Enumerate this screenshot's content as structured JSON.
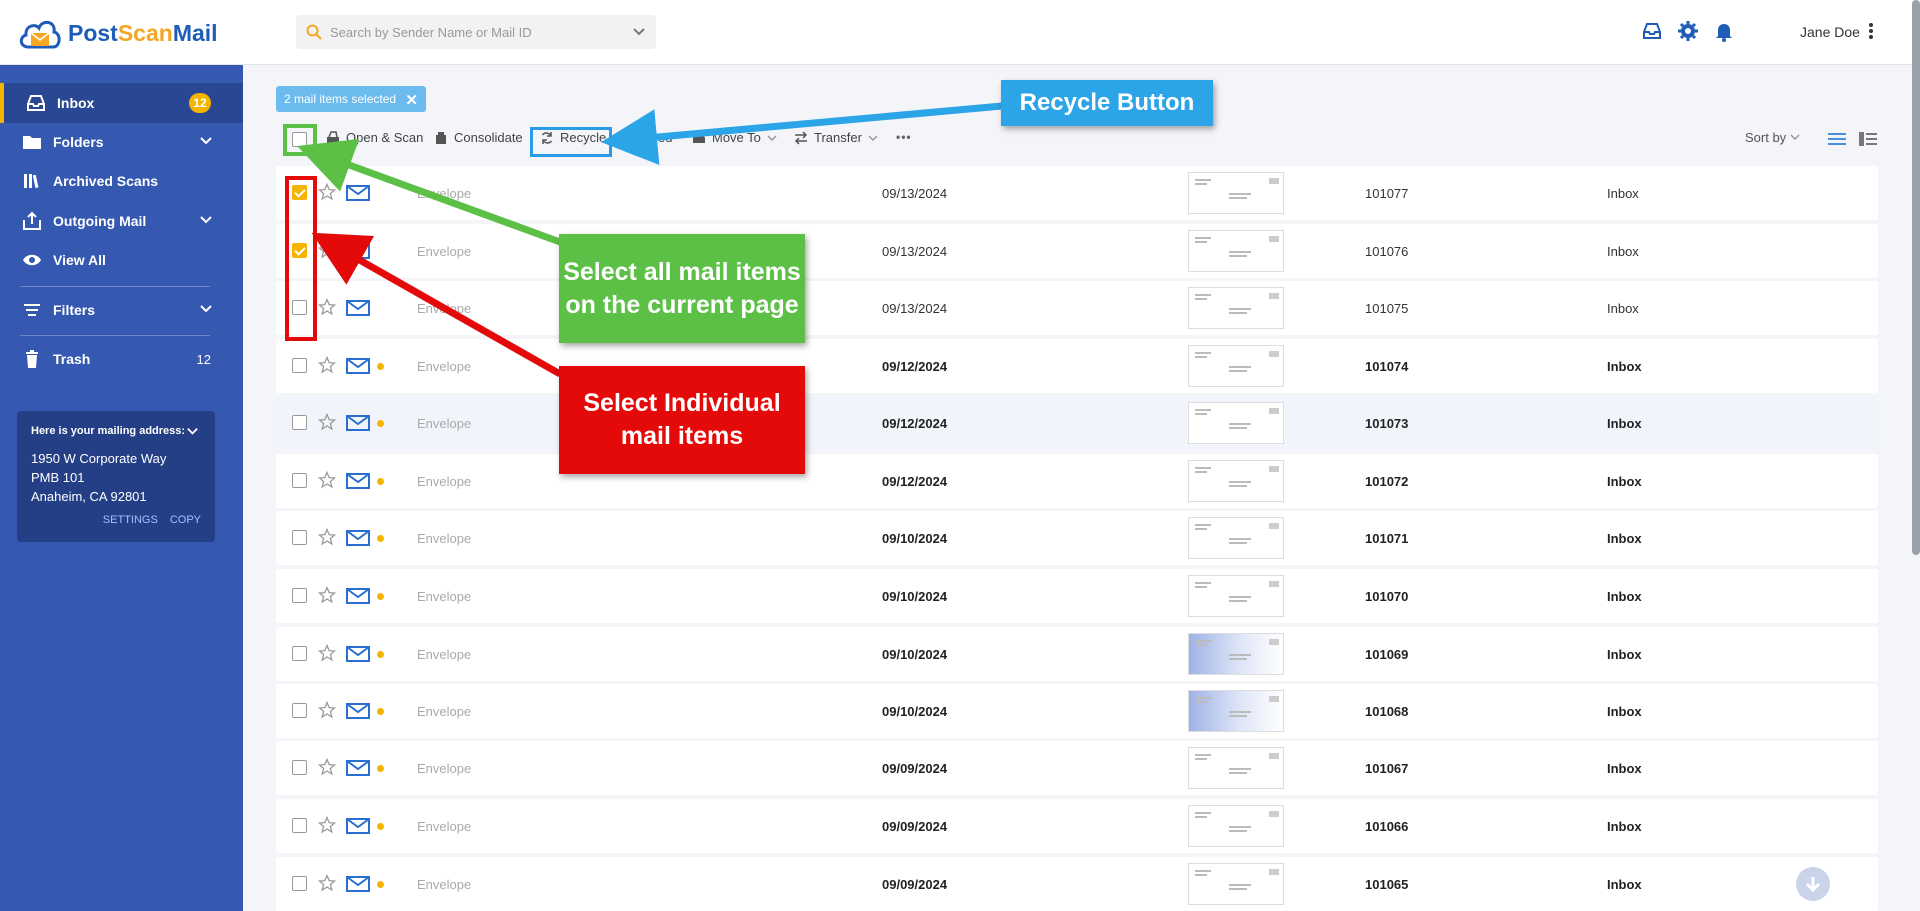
{
  "app": {
    "brand_part1": "Post",
    "brand_part2": "Scan",
    "brand_part3": "Mail",
    "user_name": "Jane Doe"
  },
  "search": {
    "placeholder": "Search by Sender Name or Mail ID"
  },
  "sidebar": {
    "items": [
      {
        "label": "Inbox",
        "badge": "12",
        "icon": "inbox-icon"
      },
      {
        "label": "Folders",
        "icon": "folder-icon"
      },
      {
        "label": "Archived Scans",
        "icon": "archive-icon"
      },
      {
        "label": "Outgoing Mail",
        "icon": "outgoing-mail-icon"
      },
      {
        "label": "View All",
        "icon": "eye-icon"
      },
      {
        "label": "Filters",
        "icon": "filter-icon"
      },
      {
        "label": "Trash",
        "count": "12",
        "icon": "trash-icon"
      }
    ],
    "address": {
      "title": "Here is your mailing address:",
      "line1": "1950 W Corporate Way",
      "line2": "PMB 101",
      "line3": "Anaheim, CA 92801",
      "settings": "SETTINGS",
      "copy": "COPY"
    }
  },
  "selection": {
    "label": "2 mail items selected"
  },
  "toolbar": {
    "open_scan": "Open & Scan",
    "consolidate": "Consolidate",
    "recycle": "Recycle",
    "shred_partial": "ed",
    "move_to": "Move To",
    "transfer": "Transfer",
    "more": "•••",
    "sort_by": "Sort by"
  },
  "rows": [
    {
      "sender": "Envelope",
      "date": "09/13/2024",
      "id": "101077",
      "location": "Inbox",
      "checked": true,
      "unread": false
    },
    {
      "sender": "Envelope",
      "date": "09/13/2024",
      "id": "101076",
      "location": "Inbox",
      "checked": true,
      "unread": false
    },
    {
      "sender": "Envelope",
      "date": "09/13/2024",
      "id": "101075",
      "location": "Inbox",
      "checked": false,
      "unread": false
    },
    {
      "sender": "Envelope",
      "date": "09/12/2024",
      "id": "101074",
      "location": "Inbox",
      "checked": false,
      "unread": true
    },
    {
      "sender": "Envelope",
      "date": "09/12/2024",
      "id": "101073",
      "location": "Inbox",
      "checked": false,
      "unread": true
    },
    {
      "sender": "Envelope",
      "date": "09/12/2024",
      "id": "101072",
      "location": "Inbox",
      "checked": false,
      "unread": true
    },
    {
      "sender": "Envelope",
      "date": "09/10/2024",
      "id": "101071",
      "location": "Inbox",
      "checked": false,
      "unread": true
    },
    {
      "sender": "Envelope",
      "date": "09/10/2024",
      "id": "101070",
      "location": "Inbox",
      "checked": false,
      "unread": true
    },
    {
      "sender": "Envelope",
      "date": "09/10/2024",
      "id": "101069",
      "location": "Inbox",
      "checked": false,
      "unread": true
    },
    {
      "sender": "Envelope",
      "date": "09/10/2024",
      "id": "101068",
      "location": "Inbox",
      "checked": false,
      "unread": true
    },
    {
      "sender": "Envelope",
      "date": "09/09/2024",
      "id": "101067",
      "location": "Inbox",
      "checked": false,
      "unread": true
    },
    {
      "sender": "Envelope",
      "date": "09/09/2024",
      "id": "101066",
      "location": "Inbox",
      "checked": false,
      "unread": true
    },
    {
      "sender": "Envelope",
      "date": "09/09/2024",
      "id": "101065",
      "location": "Inbox",
      "checked": false,
      "unread": true
    }
  ],
  "annotations": {
    "recycle": "Recycle Button",
    "select_all": "Select all mail items on the current page",
    "select_individual": "Select Individual mail items"
  },
  "colors": {
    "sidebar": "#3558b0",
    "accent": "#f5b400",
    "brand_blue": "#1e5cb8",
    "callout_blue": "#2ba4e8",
    "callout_green": "#5cbf46",
    "callout_red": "#e40a0a"
  }
}
